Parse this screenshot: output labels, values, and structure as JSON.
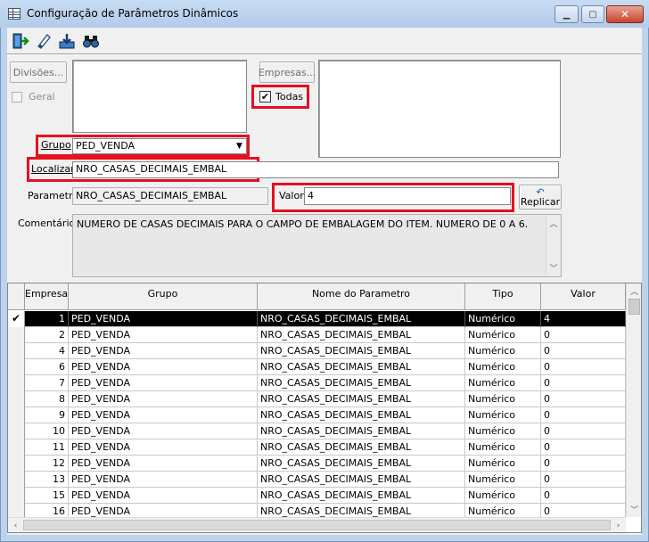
{
  "window": {
    "title": "Configuração de Parâmetros Dinâmicos",
    "minimize_glyph": "▁",
    "maximize_glyph": "▢",
    "close_glyph": "✕"
  },
  "toolbar": {
    "icons": [
      "exit-icon",
      "eraser-icon",
      "save-icon",
      "binoculars-icon"
    ]
  },
  "filters": {
    "divisoes_label": "Divisões...",
    "geral_label": "Geral",
    "empresas_label": "Empresas...",
    "todas_label": "Todas",
    "todas_checked": true,
    "grupo_label": "Grupo",
    "grupo_value": "PED_VENDA",
    "localizar_label": "Localizar",
    "localizar_value": "NRO_CASAS_DECIMAIS_EMBAL",
    "parametro_label": "Parametro",
    "parametro_value": "NRO_CASAS_DECIMAIS_EMBAL",
    "valor_label": "Valor",
    "valor_value": "4",
    "replicar_label": "Replicar",
    "comentarios_label": "Comentários",
    "comentarios_value": "NUMERO DE CASAS DECIMAIS PARA O CAMPO DE EMBALAGEM DO ITEM. NUMERO DE 0 A 6."
  },
  "grid": {
    "columns": [
      "Empresa",
      "Grupo",
      "Nome do Parametro",
      "Tipo",
      "Valor"
    ],
    "rows": [
      [
        "1",
        "PED_VENDA",
        "NRO_CASAS_DECIMAIS_EMBAL",
        "Numérico",
        "4"
      ],
      [
        "2",
        "PED_VENDA",
        "NRO_CASAS_DECIMAIS_EMBAL",
        "Numérico",
        "0"
      ],
      [
        "4",
        "PED_VENDA",
        "NRO_CASAS_DECIMAIS_EMBAL",
        "Numérico",
        "0"
      ],
      [
        "6",
        "PED_VENDA",
        "NRO_CASAS_DECIMAIS_EMBAL",
        "Numérico",
        "0"
      ],
      [
        "7",
        "PED_VENDA",
        "NRO_CASAS_DECIMAIS_EMBAL",
        "Numérico",
        "0"
      ],
      [
        "8",
        "PED_VENDA",
        "NRO_CASAS_DECIMAIS_EMBAL",
        "Numérico",
        "0"
      ],
      [
        "9",
        "PED_VENDA",
        "NRO_CASAS_DECIMAIS_EMBAL",
        "Numérico",
        "0"
      ],
      [
        "10",
        "PED_VENDA",
        "NRO_CASAS_DECIMAIS_EMBAL",
        "Numérico",
        "0"
      ],
      [
        "11",
        "PED_VENDA",
        "NRO_CASAS_DECIMAIS_EMBAL",
        "Numérico",
        "0"
      ],
      [
        "12",
        "PED_VENDA",
        "NRO_CASAS_DECIMAIS_EMBAL",
        "Numérico",
        "0"
      ],
      [
        "13",
        "PED_VENDA",
        "NRO_CASAS_DECIMAIS_EMBAL",
        "Numérico",
        "0"
      ],
      [
        "15",
        "PED_VENDA",
        "NRO_CASAS_DECIMAIS_EMBAL",
        "Numérico",
        "0"
      ],
      [
        "16",
        "PED_VENDA",
        "NRO_CASAS_DECIMAIS_EMBAL",
        "Numérico",
        "0"
      ]
    ],
    "selected_row": 0,
    "selected_glyph": "✔"
  },
  "colors": {
    "highlight_border": "#e4111f",
    "selected_row_bg": "#000000"
  }
}
